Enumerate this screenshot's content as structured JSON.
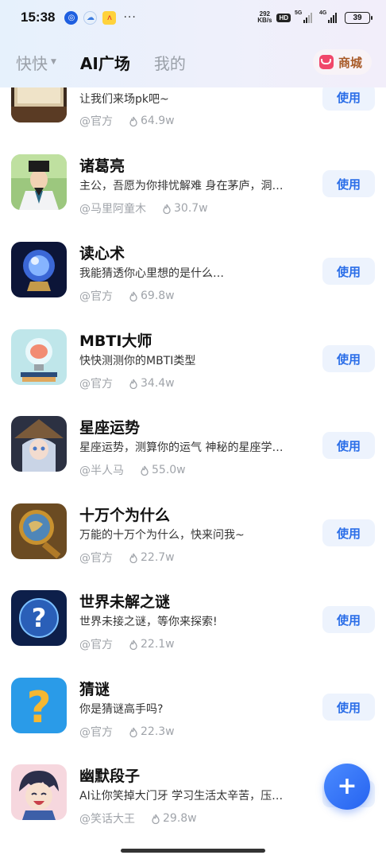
{
  "status_bar": {
    "time": "15:38",
    "net_speed_value": "292",
    "net_speed_unit": "KB/s",
    "hd_label": "HD",
    "signal1_label": "5G",
    "signal2_label": "4G",
    "battery": "39"
  },
  "nav": {
    "tabs": [
      {
        "label": "快快"
      },
      {
        "label": "AI广场"
      },
      {
        "label": "我的"
      }
    ],
    "shop_label": "商城"
  },
  "items": [
    {
      "title": "",
      "desc": "让我们来场pk吧~",
      "author": "@官方",
      "heat": "64.9w",
      "button": "使用",
      "icon": "book-thumbnail"
    },
    {
      "title": "诸葛亮",
      "desc": "主公，吾愿为你排忧解难 身在茅庐，洞…",
      "author": "@马里阿童木",
      "heat": "30.7w",
      "button": "使用",
      "icon": "zhuge-liang-avatar"
    },
    {
      "title": "读心术",
      "desc": "我能猜透你心里想的是什么…",
      "author": "@官方",
      "heat": "69.8w",
      "button": "使用",
      "icon": "crystal-ball-thumbnail"
    },
    {
      "title": "MBTI大师",
      "desc": "快快测测你的MBTI类型",
      "author": "@官方",
      "heat": "34.4w",
      "button": "使用",
      "icon": "lightbulb-brain-thumbnail"
    },
    {
      "title": "星座运势",
      "desc": "星座运势，测算你的运气 神秘的星座学…",
      "author": "@半人马",
      "heat": "55.0w",
      "button": "使用",
      "icon": "witch-girl-avatar"
    },
    {
      "title": "十万个为什么",
      "desc": "万能的十万个为什么，快来问我~",
      "author": "@官方",
      "heat": "22.7w",
      "button": "使用",
      "icon": "magnifier-globe-thumbnail"
    },
    {
      "title": "世界未解之谜",
      "desc": "世界未接之谜，等你来探索!",
      "author": "@官方",
      "heat": "22.1w",
      "button": "使用",
      "icon": "question-globe-thumbnail"
    },
    {
      "title": "猜谜",
      "desc": "你是猜谜高手吗?",
      "author": "@官方",
      "heat": "22.3w",
      "button": "使用",
      "icon": "question-mark-thumbnail"
    },
    {
      "title": "幽默段子",
      "desc": "AI让你笑掉大门牙 学习生活太辛苦，压…",
      "author": "@笑话大王",
      "heat": "29.8w",
      "button": "使用",
      "icon": "laughing-boy-avatar"
    }
  ],
  "fab": {
    "icon": "plus-icon",
    "glyph": "+"
  },
  "colors": {
    "accent": "#2b6ee8",
    "button_bg": "#edf3fd",
    "shop_text": "#a85a28",
    "shop_icon": "#f0476a",
    "muted": "#a0a4aa"
  }
}
